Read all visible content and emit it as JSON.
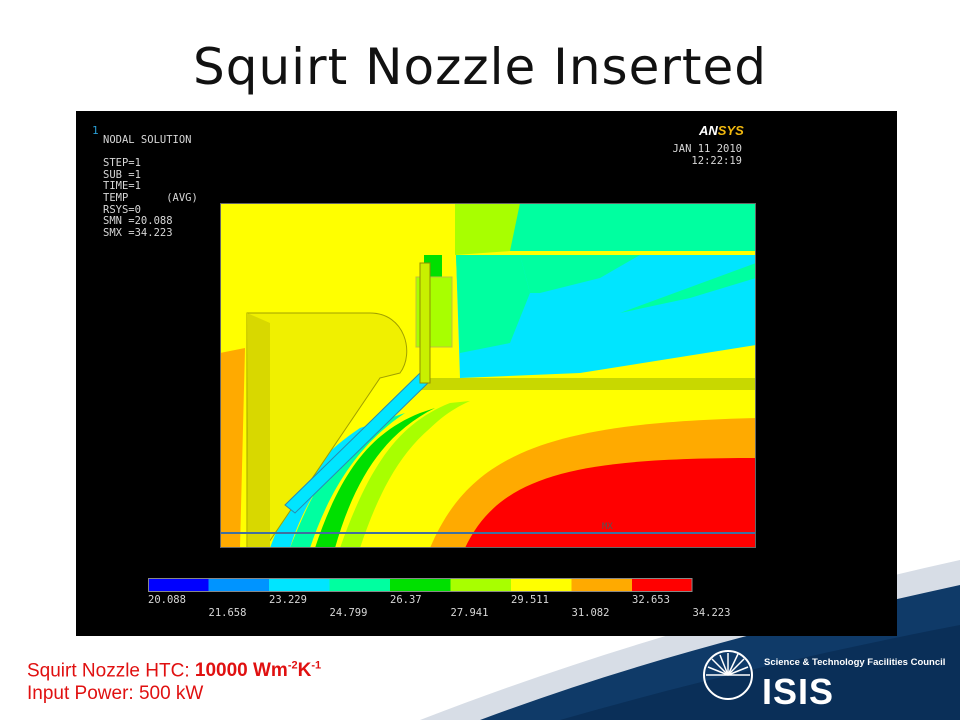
{
  "slide": {
    "title": "Squirt Nozzle Inserted"
  },
  "ansys": {
    "window_number": "1",
    "header_lines": [
      "NODAL SOLUTION",
      "",
      "STEP=1",
      "SUB =1",
      "TIME=1",
      "TEMP      (AVG)",
      "RSYS=0",
      "SMN =20.088",
      "SMX =34.223"
    ],
    "logo_prefix": "AN",
    "logo_suffix": "SYS",
    "date": "JAN 11 2010",
    "time": "12:22:19",
    "mx_label": "MX",
    "legend": {
      "colors": [
        "#0000ff",
        "#0094ff",
        "#00e5ff",
        "#00ffa0",
        "#00e000",
        "#a8ff00",
        "#ffff00",
        "#ffaa00",
        "#ff0000"
      ],
      "top_labels": [
        "20.088",
        "23.229",
        "26.37",
        "29.511",
        "32.653"
      ],
      "bottom_labels": [
        "21.658",
        "24.799",
        "27.941",
        "31.082",
        "34.223"
      ]
    }
  },
  "caption": {
    "line1_prefix": "Squirt Nozzle HTC: ",
    "line1_value": "10000 Wm",
    "exp1": "-2",
    "unit_k": "K",
    "exp2": "-1",
    "line2": "Input Power: 500 kW"
  },
  "branding": {
    "council": "Science & Technology Facilities Council",
    "facility": "ISIS"
  }
}
